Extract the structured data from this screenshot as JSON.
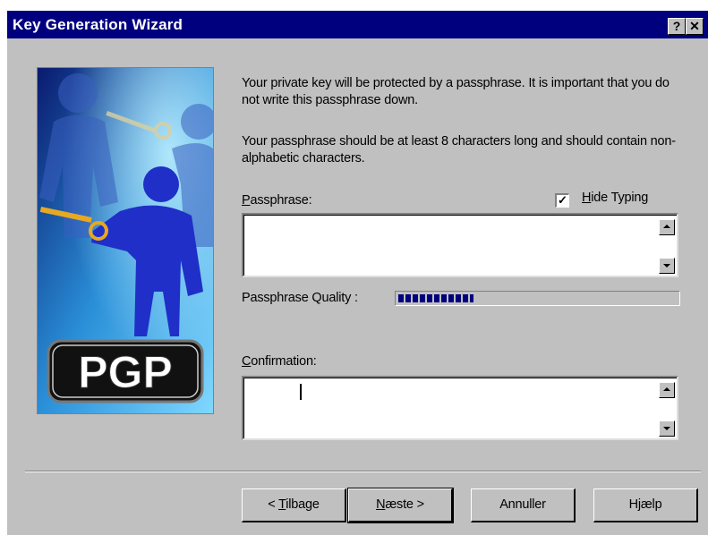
{
  "window": {
    "title": "Key Generation Wizard",
    "help_glyph": "?",
    "close_glyph": "✕"
  },
  "art": {
    "logo_text": "PGP"
  },
  "content": {
    "intro": "Your private key will be protected by a passphrase.  It is important that you do not write this passphrase down.",
    "advice": "Your passphrase should be at least 8 characters long and should contain non-alphabetic characters."
  },
  "passphrase": {
    "label_underlined": "P",
    "label_rest": "assphrase:",
    "value": ""
  },
  "hide_typing": {
    "checked": true,
    "check_glyph": "✓",
    "label_underlined": "H",
    "label_rest": "ide Typing"
  },
  "quality": {
    "label": "Passphrase Quality :",
    "fraction": 0.27
  },
  "confirmation": {
    "label_underlined": "C",
    "label_rest": "onfirmation:",
    "value": ""
  },
  "buttons": {
    "back_prefix": "< ",
    "back_underlined": "T",
    "back_rest": "ilbage",
    "next_underlined": "N",
    "next_rest": "æste >",
    "cancel": "Annuller",
    "help": "Hjælp"
  }
}
